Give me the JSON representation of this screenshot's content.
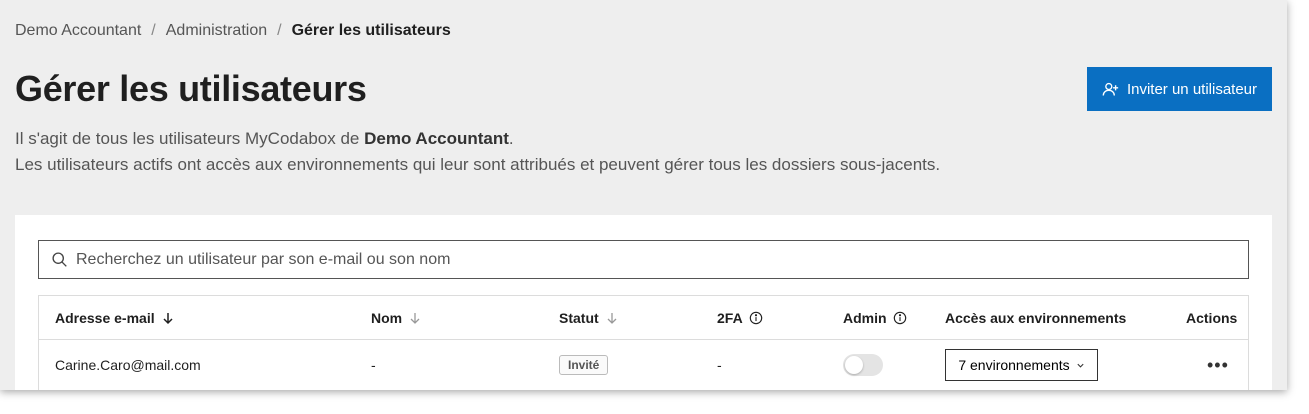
{
  "breadcrumb": {
    "items": [
      "Demo Accountant",
      "Administration"
    ],
    "separator": "/",
    "current": "Gérer les utilisateurs"
  },
  "page": {
    "title": "Gérer les utilisateurs",
    "intro_line1_prefix": "Il s'agit de tous les utilisateurs MyCodabox de ",
    "intro_line1_bold": "Demo Accountant",
    "intro_line1_suffix": ".",
    "intro_line2": "Les utilisateurs actifs ont accès aux environnements qui leur sont attribués et peuvent gérer tous les dossiers sous-jacents."
  },
  "actions": {
    "invite_label": "Inviter un utilisateur",
    "invite_icon": "user-plus-icon"
  },
  "search": {
    "placeholder": "Recherchez un utilisateur par son e-mail ou son nom",
    "value": ""
  },
  "table": {
    "columns": [
      {
        "label": "Adresse e-mail",
        "sort": "desc"
      },
      {
        "label": "Nom",
        "sort": "none"
      },
      {
        "label": "Statut",
        "sort": "none"
      },
      {
        "label": "2FA",
        "info": true
      },
      {
        "label": "Admin",
        "info": true
      },
      {
        "label": "Accès aux environnements"
      },
      {
        "label": "Actions"
      }
    ],
    "rows": [
      {
        "email": "Carine.Caro@mail.com",
        "name": "-",
        "status": "Invité",
        "twofa": "-",
        "admin": false,
        "environments": "7 environnements",
        "actions": "•••"
      }
    ]
  },
  "colors": {
    "primary": "#0a6fc2",
    "background": "#eeeeee"
  }
}
